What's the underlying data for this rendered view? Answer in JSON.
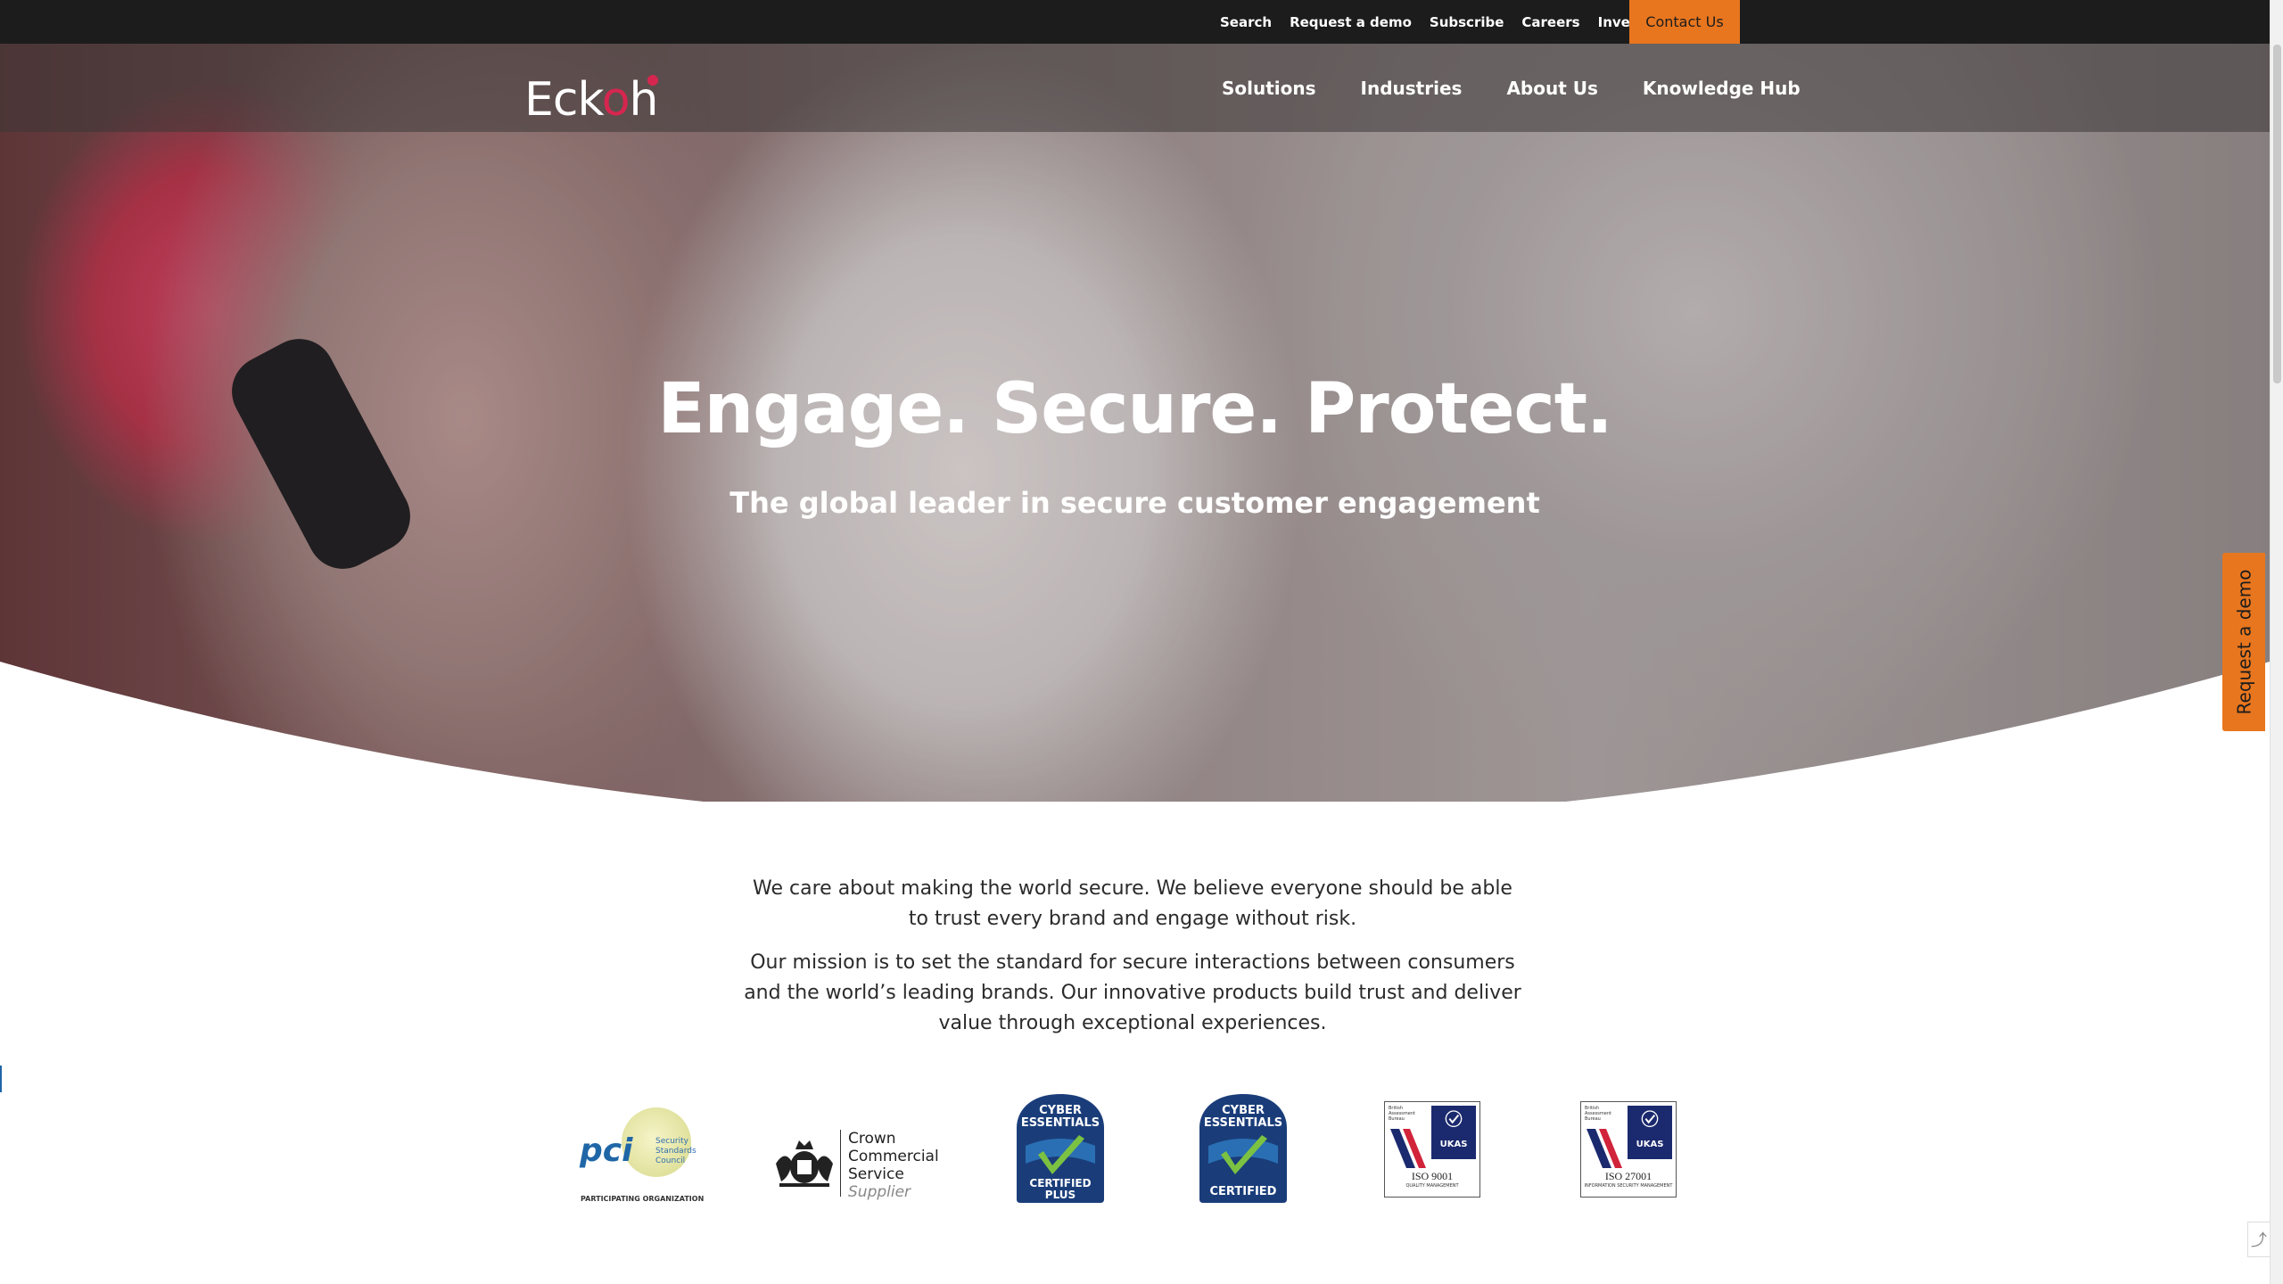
{
  "topbar": {
    "links": [
      "Search",
      "Request a demo",
      "Subscribe",
      "Careers",
      "Investors"
    ],
    "contact": "Contact Us"
  },
  "brand": {
    "logo_text": "Eckoh"
  },
  "nav": {
    "items": [
      "Solutions",
      "Industries",
      "About Us",
      "Knowledge Hub"
    ]
  },
  "hero": {
    "headline": "Engage. Secure. Protect.",
    "subheadline": "The global leader in secure customer engagement"
  },
  "side_tab": {
    "label": "Request a demo"
  },
  "intro": {
    "paragraphs": [
      "We care about making the world secure. We believe everyone should be able to trust every brand and engage without risk.",
      "Our mission is to set the standard for secure interactions between consumers and the world’s leading brands. Our innovative products build trust and deliver value through exceptional experiences."
    ]
  },
  "badges": {
    "pci": {
      "abbr": "pci",
      "org": "Security Standards Council",
      "tagline": "PARTICIPATING ORGANIZATION"
    },
    "ccs": {
      "name": "Crown Commercial Service",
      "role": "Supplier"
    },
    "cyber_plus": {
      "line1": "CYBER",
      "line2": "ESSENTIALS",
      "line3": "CERTIFIED",
      "line4": "PLUS"
    },
    "cyber": {
      "line1": "CYBER",
      "line2": "ESSENTIALS",
      "line3": "CERTIFIED"
    },
    "iso9001": {
      "bab": "British Assessment Bureau",
      "ukas": "UKAS",
      "standard": "ISO 9001",
      "desc": "QUALITY MANAGEMENT"
    },
    "iso27001": {
      "bab": "British Assessment Bureau",
      "ukas": "UKAS",
      "standard": "ISO 27001",
      "desc": "INFORMATION SECURITY MANAGEMENT"
    }
  },
  "colors": {
    "accent_orange": "#e8761e",
    "brand_red": "#d6264f",
    "topbar_bg": "#1c1c1c"
  }
}
